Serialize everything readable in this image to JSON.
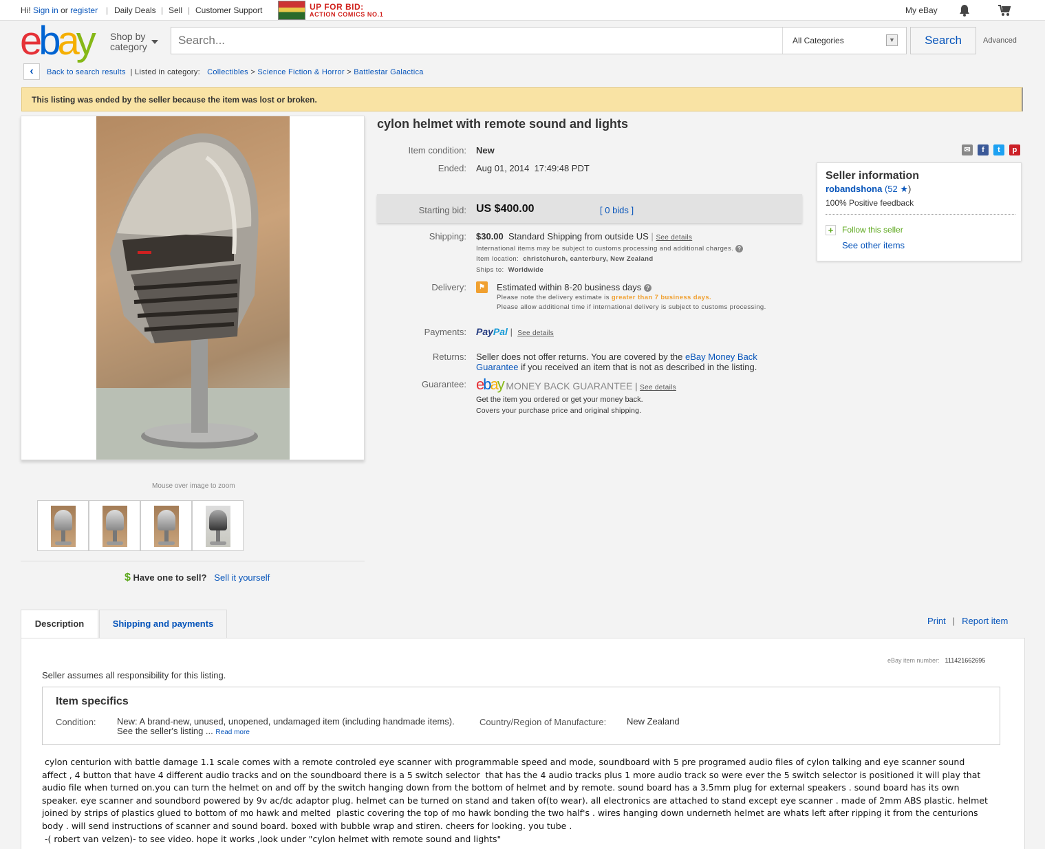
{
  "topbar": {
    "greeting": "Hi!",
    "sign_in": "Sign in",
    "or": "or",
    "register": "register",
    "daily_deals": "Daily Deals",
    "sell": "Sell",
    "customer_support": "Customer Support",
    "promo_line1": "UP FOR BID:",
    "promo_line2": "ACTION COMICS NO.1",
    "my_ebay": "My eBay"
  },
  "header": {
    "shop_by": "Shop by",
    "category": "category",
    "search_placeholder": "Search...",
    "category_select": "All Categories",
    "search_button": "Search",
    "advanced": "Advanced"
  },
  "breadcrumb": {
    "back": "Back to search results",
    "listed_in": "| Listed in category:",
    "items": [
      "Collectibles",
      "Science Fiction & Horror",
      "Battlestar Galactica"
    ],
    "separator": ">"
  },
  "banner": "This listing was ended by the seller because the item was lost or broken.",
  "gallery": {
    "zoom_hint": "Mouse over image to zoom",
    "have_one": "Have one to sell?",
    "sell_it": "Sell it yourself"
  },
  "item": {
    "title": "cylon helmet with remote sound and lights",
    "condition_label": "Item condition:",
    "condition": "New",
    "ended_label": "Ended:",
    "ended": "Aug 01, 2014  17:49:48 PDT",
    "starting_bid_label": "Starting bid:",
    "starting_bid": "US $400.00",
    "bids": "[ 0 bids ]",
    "shipping_label": "Shipping:",
    "shipping_cost": "$30.00",
    "shipping_method": "Standard Shipping from outside US",
    "see_details": "See details",
    "intl_note": "International items may be subject to customs processing and additional charges.",
    "item_location_label": "Item location:",
    "item_location": "christchurch, canterbury, New Zealand",
    "ships_to_label": "Ships to:",
    "ships_to": "Worldwide",
    "delivery_label": "Delivery:",
    "delivery_estimate": "Estimated within 8-20 business days",
    "delivery_note_pre": "Please note the delivery estimate is",
    "delivery_note_highlight": "greater than 7 business days.",
    "delivery_note2": "Please allow additional time if international delivery is subject to customs processing.",
    "payments_label": "Payments:",
    "paypal1": "Pay",
    "paypal2": "Pal",
    "returns_label": "Returns:",
    "returns_pre": "Seller does not offer returns. You are covered by the",
    "returns_link": "eBay Money Back Guarantee",
    "returns_post": "if you received an item that is not as described in the listing.",
    "guarantee_label": "Guarantee:",
    "money_back": "MONEY BACK GUARANTEE",
    "guarantee_line1": "Get the item you ordered or get your money back.",
    "guarantee_line2": "Covers your purchase price and original shipping."
  },
  "seller": {
    "heading": "Seller information",
    "name": "robandshona",
    "score": "(52",
    "score_close": ")",
    "feedback": "100% Positive feedback",
    "follow": "Follow this seller",
    "other_items": "See other items"
  },
  "tabs": {
    "description": "Description",
    "shipping": "Shipping and payments",
    "print": "Print",
    "report": "Report item"
  },
  "description": {
    "item_number_label": "eBay item number:",
    "item_number": "111421662695",
    "responsibility": "Seller assumes all responsibility for this listing.",
    "specifics_title": "Item specifics",
    "condition_label": "Condition:",
    "condition_value": "New: A brand-new, unused, unopened, undamaged item (including handmade items).",
    "condition_value2": "See the seller's listing ...",
    "read_more": "Read more",
    "country_label": "Country/Region of Manufacture:",
    "country_value": "New Zealand",
    "body": " cylon centurion with battle damage 1.1 scale comes with a remote controled eye scanner with programmable speed and mode, soundboard with 5 pre programed audio files of cylon talking and eye scanner sound affect , 4 button that have 4 different audio tracks and on the soundboard there is a 5 switch selector  that has the 4 audio tracks plus 1 more audio track so were ever the 5 switch selector is positioned it will play that audio file when turned on.you can turn the helmet on and off by the switch hanging down from the bottom of helmet and by remote. sound board has a 3.5mm plug for external speakers . sound board has its own speaker. eye scanner and soundbord powered by 9v ac/dc adaptor plug. helmet can be turned on stand and taken of(to wear). all electronics are attached to stand except eye scanner . made of 2mm ABS plastic. helmet joined by strips of plastics glued to bottom of mo hawk and melted  plastic covering the top of mo hawk bonding the two half's . wires hanging down underneth helmet are whats left after ripping it from the centurions body . will send instructions of scanner and sound board. boxed with bubble wrap and stiren. cheers for looking. you tube .\n -( robert van velzen)- to see video. hope it works ,look under \"cylon helmet with remote sound and lights\""
  }
}
